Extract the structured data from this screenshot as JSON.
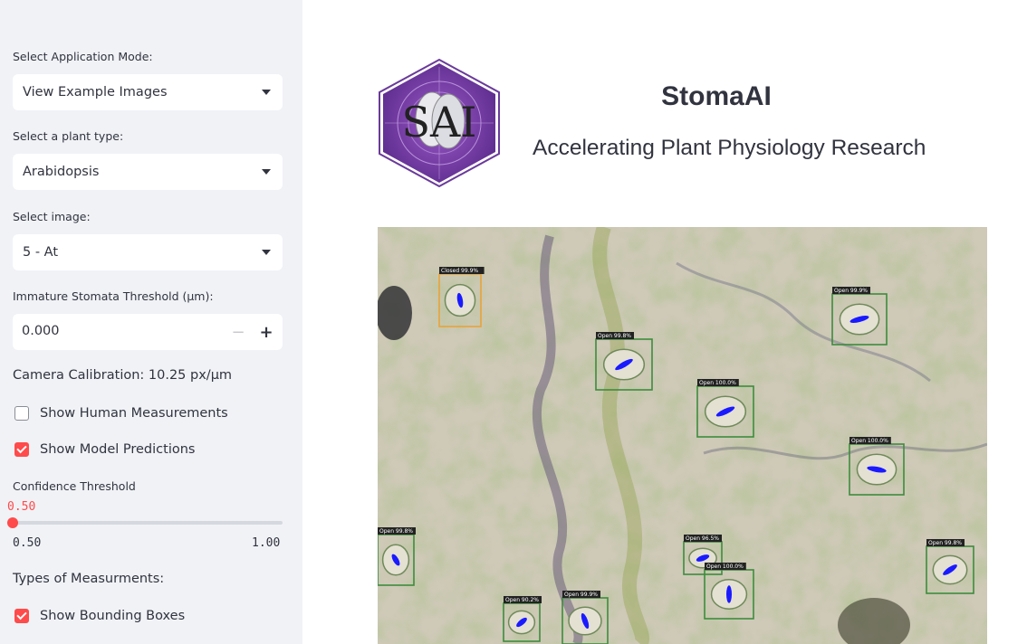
{
  "sidebar": {
    "app_mode": {
      "label": "Select Application Mode:",
      "value": "View Example Images"
    },
    "plant_type": {
      "label": "Select a plant type:",
      "value": "Arabidopsis"
    },
    "image": {
      "label": "Select image:",
      "value": "5 - At"
    },
    "threshold": {
      "label": "Immature Stomata Threshold (µm):",
      "value": "0.000",
      "minus": "−",
      "plus": "+"
    },
    "calibration": "Camera Calibration: 10.25 px/µm",
    "show_human": {
      "label": "Show Human Measurements",
      "checked": false
    },
    "show_model": {
      "label": "Show Model Predictions",
      "checked": true
    },
    "confidence": {
      "label": "Confidence Threshold",
      "value": "0.50",
      "min": "0.50",
      "max": "1.00",
      "fraction": 0.0
    },
    "measurements_heading": "Types of Measurments:",
    "show_boxes": {
      "label": "Show Bounding Boxes",
      "checked": true
    }
  },
  "header": {
    "logo_text": "SAI",
    "title": "StomaAI",
    "subtitle": "Accelerating Plant Physiology Research"
  },
  "detections": [
    {
      "label": "Closed 99.9%",
      "status": "closed"
    },
    {
      "label": "Open 99.9%",
      "status": "open"
    },
    {
      "label": "Open 99.8%",
      "status": "open"
    },
    {
      "label": "Open 100.0%",
      "status": "open"
    },
    {
      "label": "Open 100.0%",
      "status": "open"
    },
    {
      "label": "Open 99.8%",
      "status": "open"
    },
    {
      "label": "Open 96.5%",
      "status": "open"
    },
    {
      "label": "Open 100.0%",
      "status": "open"
    },
    {
      "label": "Open 99.8%",
      "status": "open"
    },
    {
      "label": "Open 90.2%",
      "status": "open"
    },
    {
      "label": "Open 99.9%",
      "status": "open"
    }
  ],
  "colors": {
    "accent": "#ff4b4b",
    "open_box": "#3c8c3c",
    "closed_box": "#e8a23a",
    "stoma_line": "#1a1aff"
  }
}
